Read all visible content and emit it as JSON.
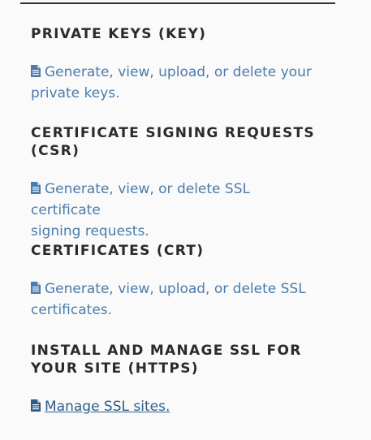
{
  "sections": [
    {
      "heading": "PRIVATE KEYS (KEY)",
      "link": {
        "line1": "Generate, view, upload, or delete your",
        "line2": "private keys."
      }
    },
    {
      "heading_line1": "CERTIFICATE SIGNING REQUESTS",
      "heading_line2": "(CSR)",
      "link": {
        "line1": "Generate, view, or delete SSL certificate",
        "line2": "signing requests."
      }
    },
    {
      "heading": "CERTIFICATES (CRT)",
      "link": {
        "line1": "Generate, view, upload, or delete SSL",
        "line2": "certificates."
      }
    },
    {
      "heading_line1": "INSTALL AND MANAGE SSL FOR",
      "heading_line2": "YOUR SITE (HTTPS)",
      "link": {
        "line1": "Manage SSL sites."
      }
    }
  ],
  "colors": {
    "link": "#4a7cad",
    "link_active": "#2e5c88",
    "heading": "#2b2b2b"
  },
  "icons": [
    "document-icon"
  ]
}
